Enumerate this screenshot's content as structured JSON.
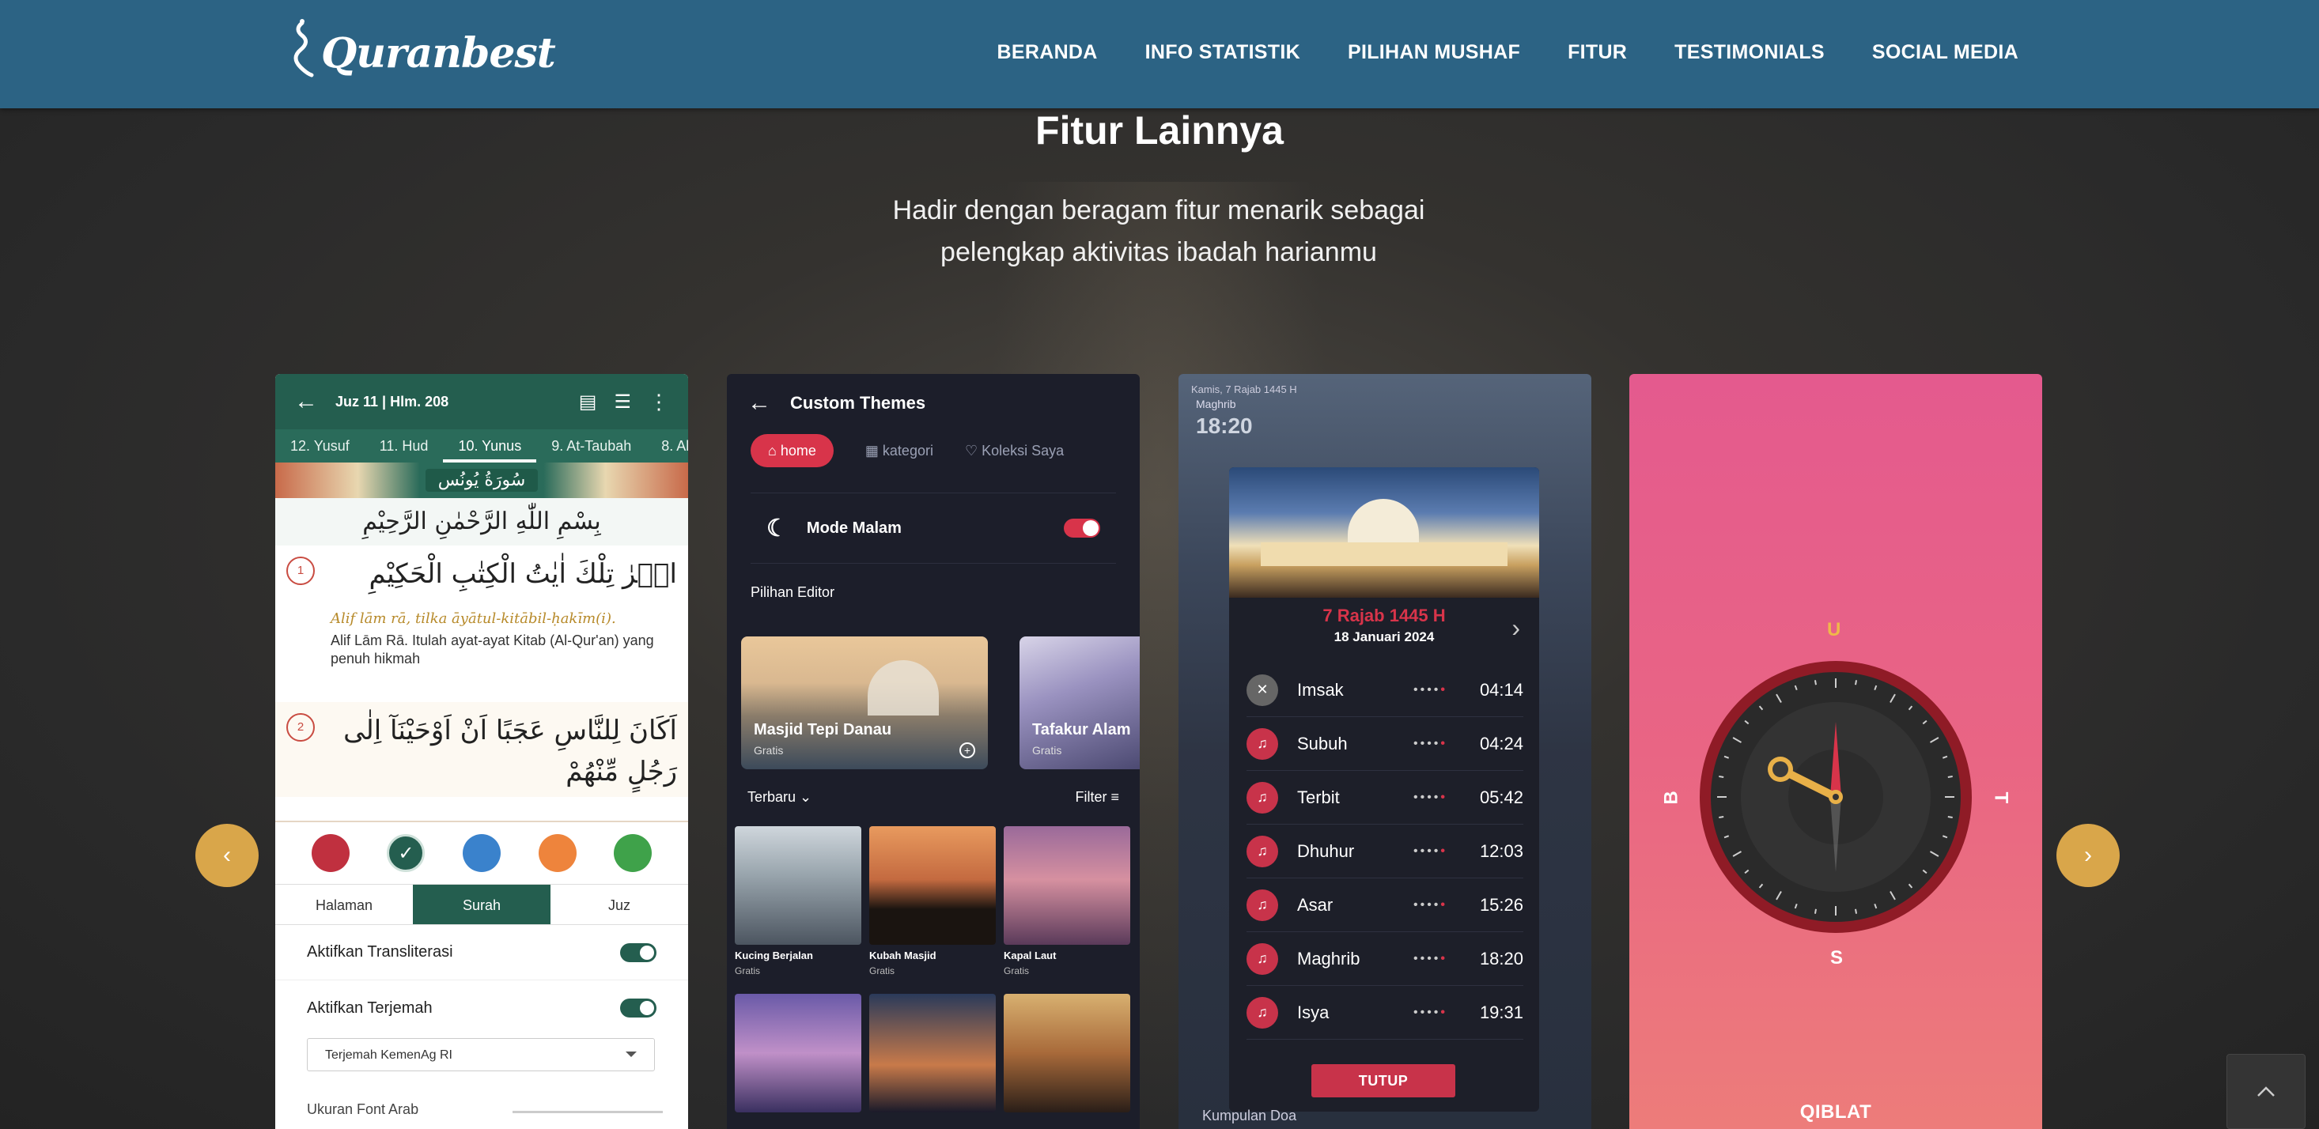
{
  "brand": {
    "name": "Quranbest"
  },
  "nav": {
    "items": [
      "BERANDA",
      "INFO STATISTIK",
      "PILIHAN MUSHAF",
      "FITUR",
      "TESTIMONIALS",
      "SOCIAL MEDIA"
    ]
  },
  "section": {
    "title": "Fitur Lainnya",
    "subtitle_line1": "Hadir dengan beragam fitur menarik sebagai",
    "subtitle_line2": "pelengkap aktivitas ibadah harianmu"
  },
  "card1": {
    "header": "Juz 11 | Hlm. 208",
    "tabs": [
      "12. Yusuf",
      "11. Hud",
      "10. Yunus",
      "9. At-Taubah",
      "8. Al-A"
    ],
    "active_tab": "10. Yunus",
    "surah_banner": "سُورَةُ يُونُس",
    "bismillah": "بِسْمِ اللّٰهِ الرَّحْمٰنِ الرَّحِيْمِ",
    "ayah1": {
      "number": "1",
      "arabic": "الۤرٰ تِلْكَ اٰيٰتُ الْكِتٰبِ الْحَكِيْمِ",
      "transliteration": "Alif lām rā, tilka āyātul-kitābil-ḥakīm(i).",
      "translation": "Alif Lām Rā. Itulah ayat-ayat Kitab (Al-Qur'an) yang penuh hikmah"
    },
    "ayah2": {
      "number": "2",
      "arabic": "اَكَانَ لِلنَّاسِ عَجَبًا اَنْ اَوْحَيْنَآ اِلٰى رَجُلٍ مِّنْهُمْ"
    },
    "colors": [
      "#c0303f",
      "#245e4f",
      "#3a82cc",
      "#ee843c",
      "#3fa24a"
    ],
    "segments": [
      "Halaman",
      "Surah",
      "Juz"
    ],
    "active_segment": "Surah",
    "toggle1": "Aktifkan Transliterasi",
    "toggle2": "Aktifkan Terjemah",
    "translation_select": "Terjemah KemenAg RI",
    "font_size_label": "Ukuran Font Arab"
  },
  "card2": {
    "header": "Custom Themes",
    "pills": [
      "home",
      "kategori",
      "Koleksi Saya"
    ],
    "mode_malam": "Mode Malam",
    "section": "Pilihan Editor",
    "featured": [
      {
        "name": "Masjid Tepi Danau",
        "price": "Gratis"
      },
      {
        "name": "Tafakur Alam",
        "price": "Gratis"
      }
    ],
    "sort": "Terbaru",
    "filter": "Filter",
    "themes": [
      {
        "name": "Kucing Berjalan",
        "price": "Gratis"
      },
      {
        "name": "Kubah Masjid",
        "price": "Gratis"
      },
      {
        "name": "Kapal Laut",
        "price": "Gratis"
      }
    ]
  },
  "card3": {
    "top_date": "Kamis, 7 Rajab 1445 H",
    "bg_prayer": "Maghrib",
    "bg_time": "18:20",
    "hijri_date": "7 Rajab 1445 H",
    "greg_date": "18 Januari 2024",
    "prayers": [
      {
        "name": "Imsak",
        "time": "04:14",
        "muted": true
      },
      {
        "name": "Subuh",
        "time": "04:24",
        "muted": false
      },
      {
        "name": "Terbit",
        "time": "05:42",
        "muted": false
      },
      {
        "name": "Dhuhur",
        "time": "12:03",
        "muted": false
      },
      {
        "name": "Asar",
        "time": "15:26",
        "muted": false
      },
      {
        "name": "Maghrib",
        "time": "18:20",
        "muted": false
      },
      {
        "name": "Isya",
        "time": "19:31",
        "muted": false
      }
    ],
    "close_button": "TUTUP",
    "footer": "Kumpulan Doa"
  },
  "card4": {
    "north": "U",
    "south": "S",
    "west": "B",
    "east": "T",
    "title": "QIBLAT"
  },
  "colors": {
    "navbar": "#2c6384",
    "accent_gold": "#d9a64a",
    "accent_red": "#d8344a",
    "green": "#245e4f"
  }
}
